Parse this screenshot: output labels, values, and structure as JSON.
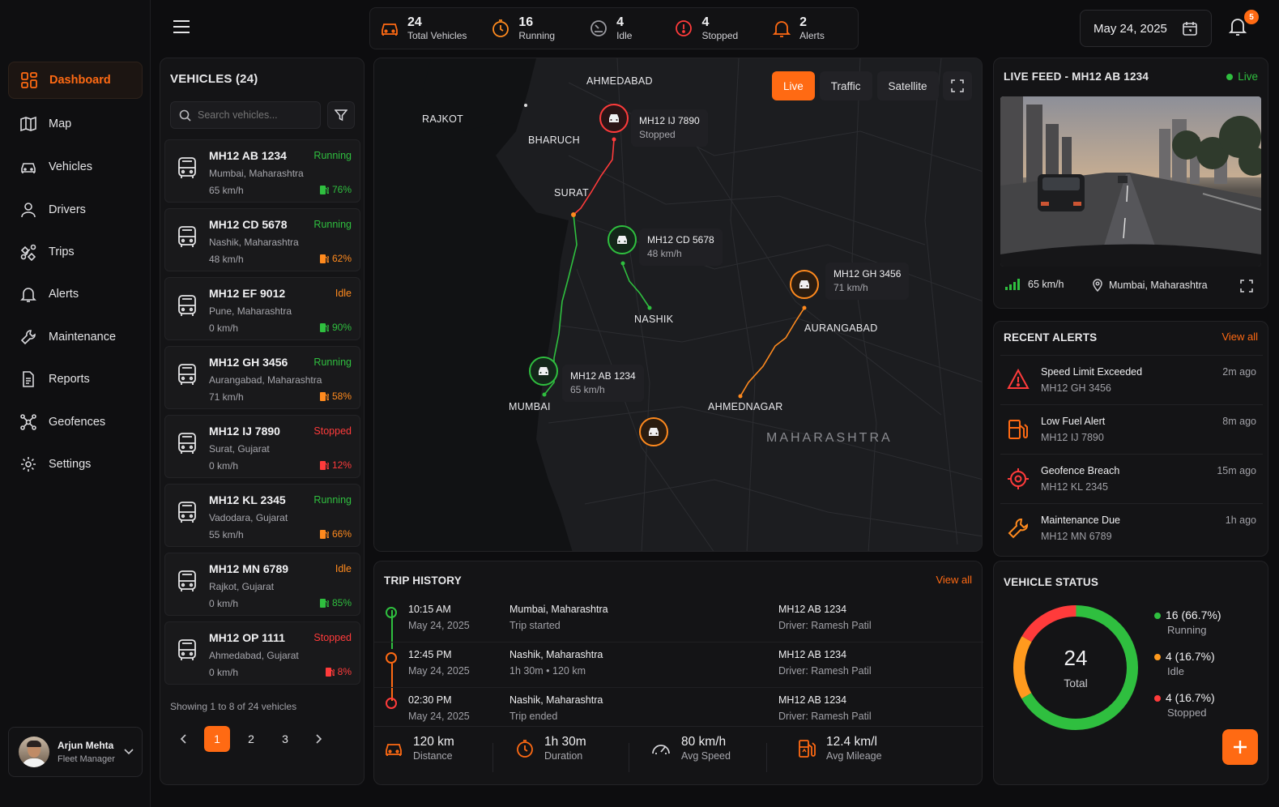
{
  "sidebar": {
    "items": [
      {
        "label": "Dashboard",
        "icon": "dashboard-icon",
        "active": true
      },
      {
        "label": "Map",
        "icon": "map-icon"
      },
      {
        "label": "Vehicles",
        "icon": "car-icon"
      },
      {
        "label": "Drivers",
        "icon": "user-icon"
      },
      {
        "label": "Trips",
        "icon": "route-icon"
      },
      {
        "label": "Alerts",
        "icon": "bell-icon"
      },
      {
        "label": "Maintenance",
        "icon": "wrench-icon"
      },
      {
        "label": "Reports",
        "icon": "report-icon"
      },
      {
        "label": "Geofences",
        "icon": "geofence-icon"
      },
      {
        "label": "Settings",
        "icon": "gear-icon"
      }
    ],
    "user": {
      "name": "Arjun Mehta",
      "role": "Fleet Manager"
    }
  },
  "stats": [
    {
      "value": "24",
      "label": "Total Vehicles",
      "icon": "car-icon",
      "color": "#ff6a13"
    },
    {
      "value": "16",
      "label": "Running",
      "icon": "clock-icon",
      "color": "#ff8a1e"
    },
    {
      "value": "4",
      "label": "Idle",
      "icon": "speedometer-icon",
      "color": "#9a9aa0"
    },
    {
      "value": "4",
      "label": "Stopped",
      "icon": "stop-icon",
      "color": "#ff3b3b"
    },
    {
      "value": "2",
      "label": "Alerts",
      "icon": "bell-icon",
      "color": "#ff6a13"
    }
  ],
  "header": {
    "date": "May 24, 2025",
    "notification_count": "5"
  },
  "vehicles": {
    "title": "VEHICLES (24)",
    "search_placeholder": "Search vehicles...",
    "list": [
      {
        "plate": "MH12 AB 1234",
        "status": "Running",
        "location": "Mumbai, Maharashtra",
        "speed": "65 km/h",
        "fuel": "76%",
        "fuel_color": "#2fbf3f"
      },
      {
        "plate": "MH12 CD 5678",
        "status": "Running",
        "location": "Nashik, Maharashtra",
        "speed": "48 km/h",
        "fuel": "62%",
        "fuel_color": "#ff8a1e"
      },
      {
        "plate": "MH12 EF 9012",
        "status": "Idle",
        "location": "Pune, Maharashtra",
        "speed": "0 km/h",
        "fuel": "90%",
        "fuel_color": "#2fbf3f"
      },
      {
        "plate": "MH12 GH 3456",
        "status": "Running",
        "location": "Aurangabad, Maharashtra",
        "speed": "71 km/h",
        "fuel": "58%",
        "fuel_color": "#ff8a1e"
      },
      {
        "plate": "MH12 IJ 7890",
        "status": "Stopped",
        "location": "Surat, Gujarat",
        "speed": "0 km/h",
        "fuel": "12%",
        "fuel_color": "#ff3b3b"
      },
      {
        "plate": "MH12 KL 2345",
        "status": "Running",
        "location": "Vadodara, Gujarat",
        "speed": "55 km/h",
        "fuel": "66%",
        "fuel_color": "#ff8a1e"
      },
      {
        "plate": "MH12 MN 6789",
        "status": "Idle",
        "location": "Rajkot, Gujarat",
        "speed": "0 km/h",
        "fuel": "85%",
        "fuel_color": "#2fbf3f"
      },
      {
        "plate": "MH12 OP 1111",
        "status": "Stopped",
        "location": "Ahmedabad, Gujarat",
        "speed": "0 km/h",
        "fuel": "8%",
        "fuel_color": "#ff3b3b"
      }
    ],
    "showing": "Showing 1 to 8 of 24 vehicles",
    "pages": [
      "1",
      "2",
      "3"
    ],
    "current_page": "1"
  },
  "map": {
    "modes": [
      "Live",
      "Traffic",
      "Satellite"
    ],
    "active_mode": "Live",
    "cities": [
      "AHMEDABAD",
      "RAJKOT",
      "BHARUCH",
      "SURAT",
      "NASHIK",
      "AURANGABAD",
      "MUMBAI",
      "AHMEDNAGAR",
      "MAHARASHTRA"
    ],
    "markers": [
      {
        "plate": "MH12 IJ 7890",
        "info": "Stopped"
      },
      {
        "plate": "MH12 CD 5678",
        "info": "48 km/h"
      },
      {
        "plate": "MH12 GH 3456",
        "info": "71 km/h"
      },
      {
        "plate": "MH12 AB 1234",
        "info": "65 km/h"
      }
    ]
  },
  "trip_history": {
    "title": "TRIP HISTORY",
    "view_all": "View all",
    "rows": [
      {
        "time": "10:15 AM",
        "date": "May 24, 2025",
        "place": "Mumbai, Maharashtra",
        "detail": "Trip started",
        "vehicle": "MH12 AB 1234",
        "driver": "Driver: Ramesh Patil",
        "color": "#2fbf3f"
      },
      {
        "time": "12:45 PM",
        "date": "May 24, 2025",
        "place": "Nashik, Maharashtra",
        "detail": "1h 30m • 120 km",
        "vehicle": "MH12 AB 1234",
        "driver": "Driver: Ramesh Patil",
        "color": "#ff6a13"
      },
      {
        "time": "02:30 PM",
        "date": "May 24, 2025",
        "place": "Nashik, Maharashtra",
        "detail": "Trip ended",
        "vehicle": "MH12 AB 1234",
        "driver": "Driver: Ramesh Patil",
        "color": "#ff3b3b"
      }
    ],
    "summary": [
      {
        "value": "120 km",
        "label": "Distance",
        "icon": "car-icon"
      },
      {
        "value": "1h 30m",
        "label": "Duration",
        "icon": "clock-icon"
      },
      {
        "value": "80 km/h",
        "label": "Avg Speed",
        "icon": "speedometer-icon"
      },
      {
        "value": "12.4 km/l",
        "label": "Avg Mileage",
        "icon": "fuel-icon"
      }
    ]
  },
  "live_feed": {
    "title": "LIVE FEED - MH12 AB 1234",
    "status": "Live",
    "speed": "65 km/h",
    "location": "Mumbai, Maharashtra"
  },
  "alerts": {
    "title": "RECENT ALERTS",
    "view_all": "View all",
    "items": [
      {
        "title": "Speed Limit Exceeded",
        "vehicle": "MH12 GH 3456",
        "time": "2m ago",
        "icon": "warning-icon"
      },
      {
        "title": "Low Fuel Alert",
        "vehicle": "MH12 IJ 7890",
        "time": "8m ago",
        "icon": "fuel-icon"
      },
      {
        "title": "Geofence Breach",
        "vehicle": "MH12 KL 2345",
        "time": "15m ago",
        "icon": "target-icon"
      },
      {
        "title": "Maintenance Due",
        "vehicle": "MH12 MN 6789",
        "time": "1h ago",
        "icon": "wrench-icon"
      }
    ]
  },
  "vehicle_status": {
    "title": "VEHICLE STATUS",
    "total": "24",
    "total_label": "Total",
    "segments": [
      {
        "value": "16 (66.7%)",
        "label": "Running",
        "color": "#2fbf3f",
        "fraction": 0.667
      },
      {
        "value": "4 (16.7%)",
        "label": "Idle",
        "color": "#ff9a1e",
        "fraction": 0.167
      },
      {
        "value": "4 (16.7%)",
        "label": "Stopped",
        "color": "#ff3b3b",
        "fraction": 0.167
      }
    ]
  }
}
